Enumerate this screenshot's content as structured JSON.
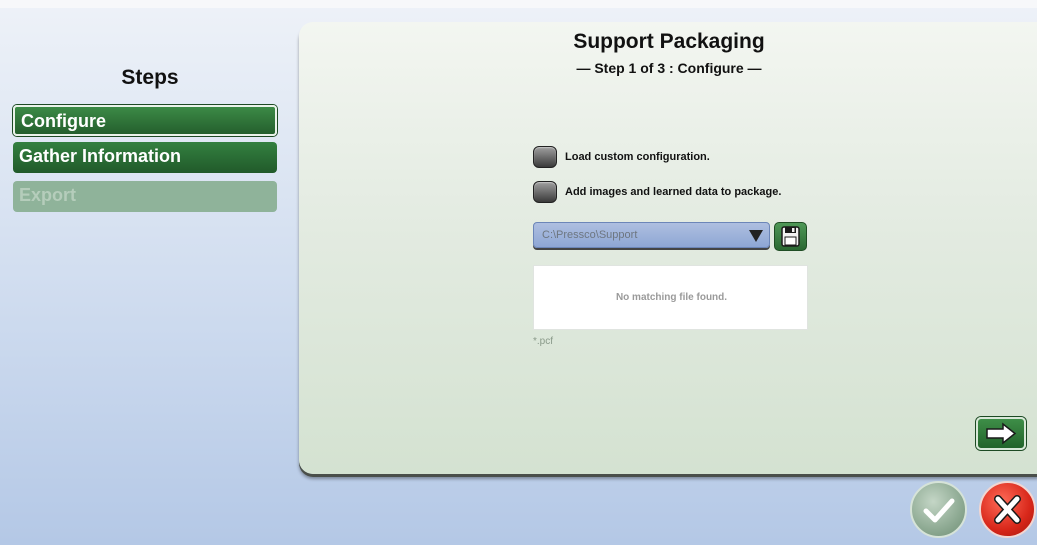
{
  "steps": {
    "title": "Steps",
    "items": [
      {
        "label": "Configure",
        "state": "active"
      },
      {
        "label": "Gather Information",
        "state": "enabled"
      },
      {
        "label": "Export",
        "state": "disabled"
      }
    ]
  },
  "panel": {
    "title": "Support Packaging",
    "subtitle": "— Step 1 of 3 : Configure —",
    "options": [
      {
        "label": "Load custom configuration.",
        "checked": false
      },
      {
        "label": "Add images and learned data to package.",
        "checked": false
      }
    ],
    "path": {
      "value": "C:\\Pressco\\Support"
    },
    "files": {
      "empty_message": "No matching file found."
    },
    "filter": "*.pcf"
  },
  "icons": {
    "checkbox": "round-toggle-icon",
    "dropdown": "triangle-down-icon",
    "save": "floppy-disk-icon",
    "next": "arrow-right-icon",
    "ok": "checkmark-icon",
    "cancel": "x-icon"
  },
  "colors": {
    "accent_green": "#2d6f35",
    "cancel_red": "#d8271a"
  }
}
